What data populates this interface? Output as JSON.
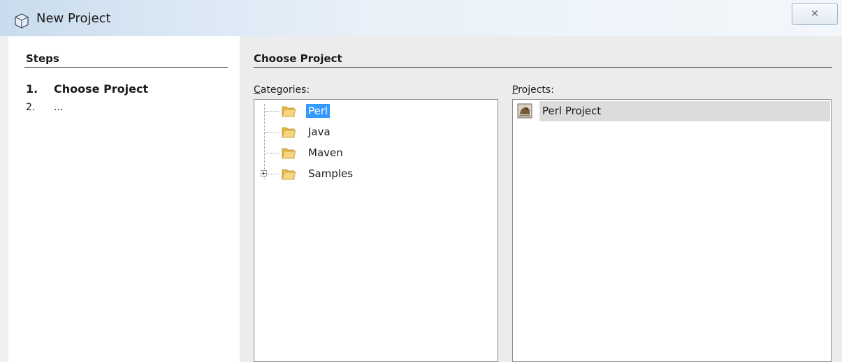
{
  "window": {
    "title": "New Project",
    "close_symbol": "✕"
  },
  "steps": {
    "title": "Steps",
    "items": [
      {
        "number": "1.",
        "label": "Choose Project"
      },
      {
        "number": "2.",
        "label": "..."
      }
    ]
  },
  "main": {
    "title": "Choose Project",
    "categories_label": {
      "mnemonic": "C",
      "rest": "ategories:"
    },
    "projects_label": {
      "mnemonic": "P",
      "rest": "rojects:"
    },
    "categories": [
      {
        "label": "Perl",
        "selected": true
      },
      {
        "label": "Java",
        "selected": false
      },
      {
        "label": "Maven",
        "selected": false
      },
      {
        "label": "Samples",
        "selected": false,
        "expandable": true
      }
    ],
    "projects": [
      {
        "label": "Perl Project",
        "selected": true
      }
    ]
  },
  "colors": {
    "selection": "#3399ff",
    "folder": "#f0c95a",
    "panel": "#ececec"
  },
  "icons": {
    "window": "cube-icon",
    "folder": "folder-icon",
    "project": "perl-project-icon"
  }
}
